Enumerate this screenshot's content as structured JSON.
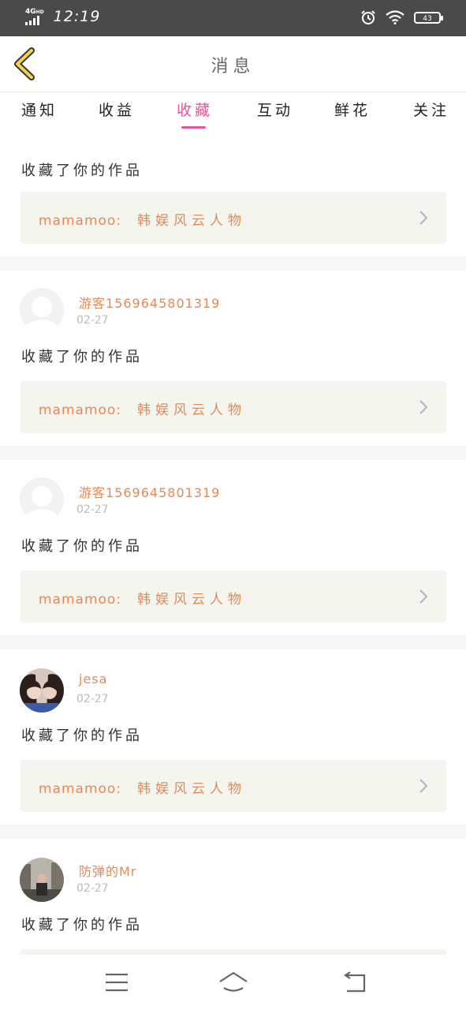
{
  "status_bar": {
    "network": "4G",
    "network_sup": "HD",
    "time": "12:19",
    "battery": "43"
  },
  "header": {
    "title": "消息",
    "back_icon": "chevron-left-icon"
  },
  "tabs": [
    {
      "label": "通知",
      "active": false
    },
    {
      "label": "收益",
      "active": false
    },
    {
      "label": "收藏",
      "active": true
    },
    {
      "label": "互动",
      "active": false
    },
    {
      "label": "鲜花",
      "active": false
    },
    {
      "label": "关注",
      "active": false
    }
  ],
  "messages": [
    {
      "user": "",
      "date": "",
      "action": "收藏了你的作品",
      "work_author": "mamamoo:",
      "work_title": "韩娱风云人物"
    },
    {
      "user": "游客1569645801319",
      "date": "02-27",
      "action": "收藏了你的作品",
      "work_author": "mamamoo:",
      "work_title": "韩娱风云人物"
    },
    {
      "user": "游客1569645801319",
      "date": "02-27",
      "action": "收藏了你的作品",
      "work_author": "mamamoo:",
      "work_title": "韩娱风云人物"
    },
    {
      "user": "jesa",
      "date": "02-27",
      "action": "收藏了你的作品",
      "work_author": "mamamoo:",
      "work_title": "韩娱风云人物"
    },
    {
      "user": "防弹的Mr",
      "date": "02-27",
      "action": "收藏了你的作品"
    }
  ],
  "colors": {
    "accent": "#e2559a",
    "username": "#e48a55",
    "status_bar": "#4a4a4a",
    "work_bg": "#f5f5ef"
  }
}
